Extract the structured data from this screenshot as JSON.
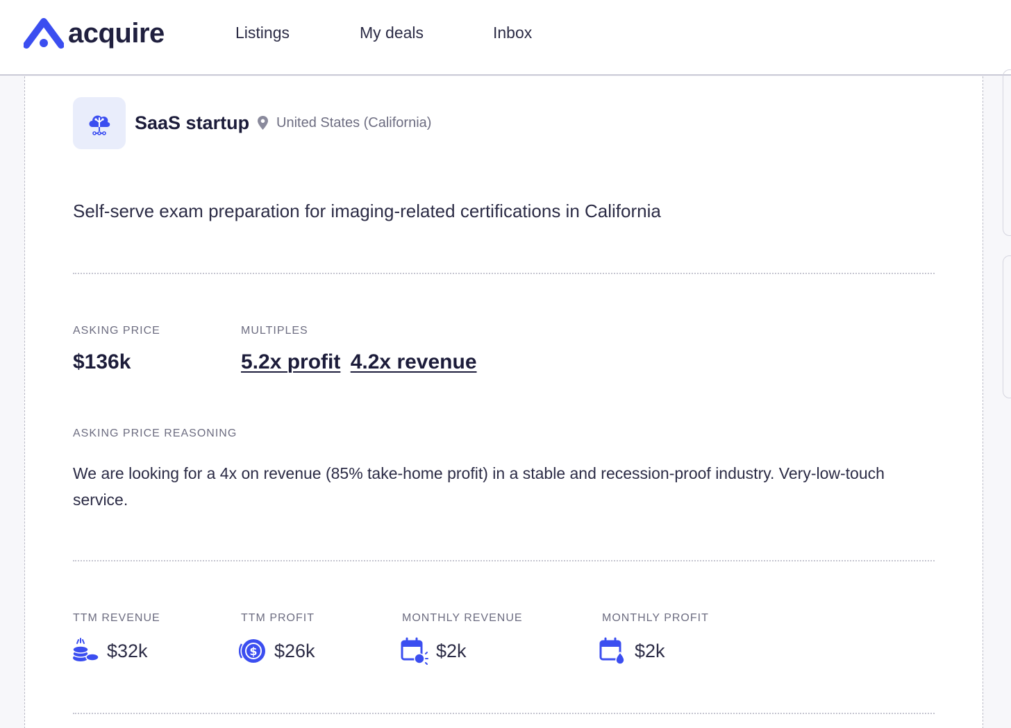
{
  "nav": {
    "logo_text": "acquire",
    "links": [
      "Listings",
      "My deals",
      "Inbox"
    ]
  },
  "listing": {
    "company_type": "SaaS startup",
    "location": "United States (California)",
    "headline": "Self-serve exam preparation for imaging-related certifications in California",
    "asking_price_label": "ASKING PRICE",
    "asking_price": "$136k",
    "multiples_label": "MULTIPLES",
    "multiple_profit": "5.2x profit",
    "multiple_revenue": "4.2x revenue",
    "reasoning_label": "ASKING PRICE REASONING",
    "reasoning": "We are looking for a 4x on revenue (85% take-home profit) in a stable and recession-proof industry. Very-low-touch service."
  },
  "metrics": [
    {
      "label": "TTM REVENUE",
      "value": "$32k",
      "icon": "coins-stack-icon"
    },
    {
      "label": "TTM PROFIT",
      "value": "$26k",
      "icon": "dollar-circle-icon"
    },
    {
      "label": "MONTHLY REVENUE",
      "value": "$2k",
      "icon": "calendar-revenue-icon"
    },
    {
      "label": "MONTHLY PROFIT",
      "value": "$2k",
      "icon": "calendar-profit-icon"
    }
  ],
  "colors": {
    "brand": "#3b4ef0",
    "text_dark": "#1c1c3a",
    "text_muted": "#6c6c80",
    "icon_bg": "#e9edfb"
  }
}
